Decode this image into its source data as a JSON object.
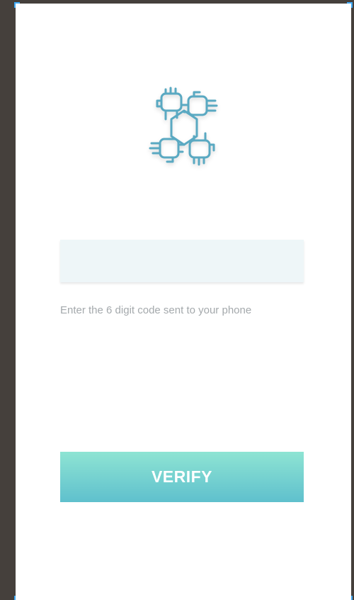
{
  "logo": {
    "icon": "hands-together-icon",
    "stroke_color": "#5aa9c2"
  },
  "code_input": {
    "value": "",
    "placeholder": ""
  },
  "hint": {
    "text": "Enter the 6 digit code sent to your phone"
  },
  "verify_button": {
    "label": "VERIFY",
    "gradient_top": "#8ee4d3",
    "gradient_bottom": "#5fc0cd"
  },
  "colors": {
    "canvas_background": "#45403c",
    "artboard": "#ffffff",
    "input_background": "#eef6f8",
    "hint_text": "#a4a9ac",
    "selection_handles": "#3fa9f5"
  }
}
